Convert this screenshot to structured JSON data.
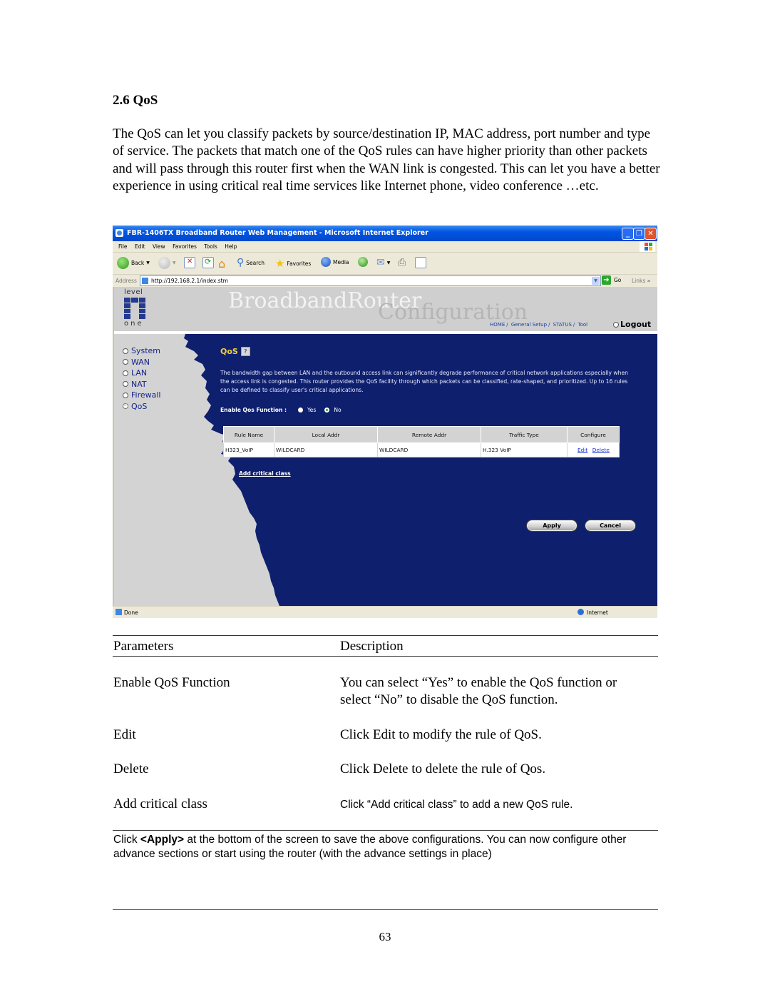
{
  "document": {
    "section_title": "2.6 QoS",
    "intro_paragraph": "The QoS can let you classify packets by source/destination IP, MAC address, port number and type of  service. The packets that match one of the QoS rules can have higher priority than other packets and will pass through this router first when the WAN link is congested. This can let you have a better experience in using critical real time services like Internet phone, video conference …etc.",
    "page_number": "63"
  },
  "browser": {
    "window_title": "FBR-1406TX Broadband Router Web Management - Microsoft Internet Explorer",
    "window_buttons": {
      "minimize": "_",
      "restore": "❐",
      "close": "✕"
    },
    "menu": [
      "File",
      "Edit",
      "View",
      "Favorites",
      "Tools",
      "Help"
    ],
    "toolbar": {
      "back": "Back",
      "search": "Search",
      "favorites": "Favorites",
      "media": "Media"
    },
    "address_label": "Address",
    "address_value": "http://192.168.2.1/index.stm",
    "go_label": "Go",
    "links_label": "Links",
    "links_more": "»",
    "status_text": "Done",
    "zone_text": "Internet"
  },
  "router": {
    "logo_top": "level",
    "logo_bottom": "one",
    "banner_line1": "BroadbandRouter",
    "banner_line2": "Configuration",
    "topnav": [
      "HOME",
      "General Setup",
      "STATUS",
      "Tool"
    ],
    "logout": "Logout",
    "sidebar": [
      {
        "label": "System",
        "active": false
      },
      {
        "label": "WAN",
        "active": false
      },
      {
        "label": "LAN",
        "active": false
      },
      {
        "label": "NAT",
        "active": false
      },
      {
        "label": "Firewall",
        "active": false
      },
      {
        "label": "QoS",
        "active": true
      }
    ],
    "page_title": "QoS",
    "help_icon": "?",
    "description": "The bandwidth gap between LAN and the outbound access link can significantly degrade performance of critical network applications especially when the access link is congested. This router provides the QoS facility through which packets can be classified, rate-shaped, and prioritized. Up to 16 rules can be defined to classify user's critical applications.",
    "enable_label": "Enable Qos Function :",
    "enable_options": [
      "Yes",
      "No"
    ],
    "enable_selected": "No",
    "table": {
      "headers": [
        "Rule Name",
        "Local Addr",
        "Remote Addr",
        "Traffic Type",
        "Configure"
      ],
      "rows": [
        {
          "rule_name": "H323_VoIP",
          "local_addr": "WILDCARD",
          "remote_addr": "WILDCARD",
          "traffic_type": "H.323 VoIP",
          "edit": "Edit",
          "delete": "Delete"
        }
      ]
    },
    "add_link": "Add critical class",
    "apply_label": "Apply",
    "cancel_label": "Cancel"
  },
  "params_table": {
    "headers": [
      "Parameters",
      "Description"
    ],
    "rows": [
      {
        "param": "Enable QoS Function",
        "desc_line1": "You can select “Yes” to enable the QoS function or",
        "desc_line2": "select “No” to disable the QoS function."
      },
      {
        "param": "Edit",
        "desc_line1": "Click Edit to modify the rule of QoS."
      },
      {
        "param": "Delete",
        "desc_line1": "Click Delete to delete the rule of Qos."
      },
      {
        "param": "Add critical class",
        "desc_line1": "Click “Add critical class” to add a new QoS rule."
      }
    ]
  },
  "footnote": {
    "prefix": "Click ",
    "bold": "<Apply>",
    "suffix": " at the bottom of the screen to save the above configurations. You can now configure other advance sections or start using the router (with the advance settings in place)"
  },
  "colors": {
    "router_blue": "#0e1f6e",
    "router_gray": "#d3d3d3",
    "qos_title_yellow": "#f2d234",
    "xp_titlebar": "#0054e3"
  }
}
